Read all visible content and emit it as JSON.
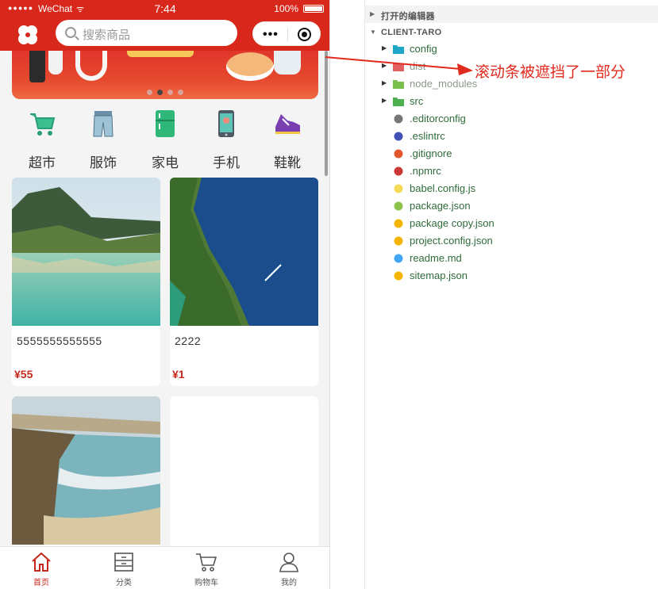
{
  "status_bar": {
    "signal": "●●●●●",
    "carrier": "WeChat",
    "wifi": "ᯤ",
    "time": "7:44",
    "battery": "100%"
  },
  "header": {
    "search_placeholder": "搜索商品",
    "capsule_more": "•••"
  },
  "banner": {
    "dots": 4,
    "active_dot": 1
  },
  "categories": [
    {
      "label": "超市",
      "icon": "shopping-cart-icon"
    },
    {
      "label": "服饰",
      "icon": "jeans-icon"
    },
    {
      "label": "家电",
      "icon": "fridge-icon"
    },
    {
      "label": "手机",
      "icon": "smartphone-icon"
    },
    {
      "label": "鞋靴",
      "icon": "sneaker-icon"
    }
  ],
  "products": [
    {
      "name": "5555555555555",
      "price": "¥55"
    },
    {
      "name": "2222",
      "price": "¥1"
    },
    {
      "name": "",
      "price": ""
    },
    {
      "name": "",
      "price": ""
    }
  ],
  "tabbar": [
    {
      "label": "首页",
      "icon": "home-icon",
      "active": true
    },
    {
      "label": "分类",
      "icon": "category-icon",
      "active": false
    },
    {
      "label": "购物车",
      "icon": "cart-icon",
      "active": false
    },
    {
      "label": "我的",
      "icon": "user-icon",
      "active": false
    }
  ],
  "explorer": {
    "open_editors": "打开的编辑器",
    "project": "CLIENT-TARO",
    "items": [
      {
        "label": "config",
        "kind": "folder",
        "color": "#1fa7c9"
      },
      {
        "label": "dist",
        "kind": "folder",
        "color": "#e06060"
      },
      {
        "label": "node_modules",
        "kind": "folder",
        "color": "#7bbf4e"
      },
      {
        "label": "src",
        "kind": "folder",
        "color": "#4caf50"
      },
      {
        "label": ".editorconfig",
        "kind": "file",
        "color": "#777777"
      },
      {
        "label": ".eslintrc",
        "kind": "file",
        "color": "#3f51b5"
      },
      {
        "label": ".gitignore",
        "kind": "file",
        "color": "#e4572e"
      },
      {
        "label": ".npmrc",
        "kind": "file",
        "color": "#cb3837"
      },
      {
        "label": "babel.config.js",
        "kind": "file",
        "color": "#f5da55"
      },
      {
        "label": "package.json",
        "kind": "file",
        "color": "#8bc34a"
      },
      {
        "label": "package copy.json",
        "kind": "file",
        "color": "#f5b400"
      },
      {
        "label": "project.config.json",
        "kind": "file",
        "color": "#f5b400"
      },
      {
        "label": "readme.md",
        "kind": "file",
        "color": "#42a5f5"
      },
      {
        "label": "sitemap.json",
        "kind": "file",
        "color": "#f5b400"
      }
    ]
  },
  "annotation": {
    "text": "滚动条被遮挡了一部分",
    "color": "#e02a1e"
  },
  "colors": {
    "brand_red": "#d8271b",
    "price_red": "#c4281d"
  }
}
